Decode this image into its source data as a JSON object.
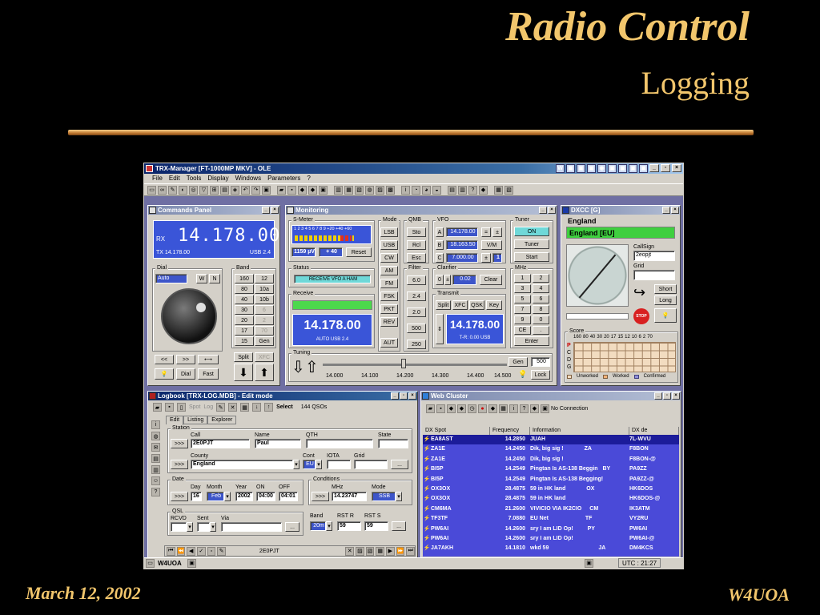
{
  "slide": {
    "title": "Radio Control",
    "subtitle": "Logging",
    "date": "March 12, 2002",
    "callsign": "W4UOA"
  },
  "app": {
    "title": "TRX-Manager [FT-1000MP MKV] - OLE",
    "menu": [
      "File",
      "Edit",
      "Tools",
      "Display",
      "Windows",
      "Parameters",
      "?"
    ],
    "status_left": "W4UOA",
    "status_clock": "UTC : 21:27"
  },
  "commands_panel": {
    "title": "Commands Panel",
    "freq_big": "14.178.00",
    "rx": "RX",
    "tx_freq": "TX 14.178.00",
    "mode_bw": "USB 2.4",
    "dial_label": "Dial",
    "dial_mode": "Auto",
    "w": "W",
    "n": "N",
    "band_label": "Band",
    "bands": [
      "160",
      "12",
      "80",
      "10a",
      "40",
      "10b",
      "30",
      "6",
      "20",
      "2",
      "17",
      "70",
      "15",
      "Gen"
    ],
    "split": "Split",
    "xfc": "XFC",
    "dial_btn": "Dial",
    "fast_btn": "Fast",
    "nav_left": "<<",
    "nav_right": ">>"
  },
  "monitoring": {
    "title": "Monitoring",
    "smeter_label": "S-Meter",
    "smeter_scale": "1 2 3 4 5 6 7 8 9 +20 +40 +60",
    "microvolt": "1159 µV",
    "db": "+ 40",
    "reset": "Reset",
    "status_label": "Status",
    "status_text": "RECEIVE VFO A HAM",
    "receive_label": "Receive",
    "rx_freq": "14.178.00",
    "rx_mode": "AUTO USB 2.4",
    "mode_label": "Mode",
    "modes": [
      "LSB",
      "USB",
      "CW",
      "AM",
      "FM",
      "FSK",
      "PKT",
      "REV",
      "AUT"
    ],
    "qmb_label": "QMB",
    "qmb": [
      "Sto",
      "Rcl",
      "Esc"
    ],
    "filter_label": "Filter",
    "filters": [
      "6.0",
      "2.4",
      "2.0",
      "500",
      "250"
    ],
    "vfo_label": "VFO",
    "vfo_a_key": "A",
    "vfo_a": "14.178.00",
    "vfo_b_key": "B",
    "vfo_b": "18.163.50",
    "vfo_c_key": "C",
    "vfo_c": "7.000.00",
    "eq": "=",
    "vm": "V/M",
    "one": "1",
    "clarifier_label": "Clarifier",
    "clar_val": "0.02",
    "clar_zero": "0",
    "clear": "Clear",
    "transmit_label": "Transmit",
    "tx_btns": [
      "Split",
      "XFC",
      "QSK",
      "Key"
    ],
    "tx_freq": "14.178.00",
    "tx_info": "T-R: 0.00 USB",
    "tuning_label": "Tuning",
    "tuning_scale": [
      "14.000",
      "14.100",
      "14.200",
      "14.300",
      "14.400",
      "14.500"
    ],
    "gen": "Gen",
    "step": "500",
    "lock": "Lock",
    "tuner_label": "Tuner",
    "tuner_on": "ON",
    "tuner_btn": "Tuner",
    "start_btn": "Start",
    "mhz_label": "MHz",
    "keypad": [
      "1",
      "2",
      "3",
      "4",
      "5",
      "6",
      "7",
      "8",
      "9",
      "0",
      "CE",
      ".",
      "Enter"
    ]
  },
  "dxcc": {
    "title": "DXCC [G]",
    "country": "England",
    "country_code": "England [EU]",
    "callsign_label": "CallSign",
    "callsign": "2eopjt",
    "grid_label": "Grid",
    "short": "Short",
    "long": "Long",
    "stop": "STOP",
    "score_label": "Score",
    "score_bands": [
      "160",
      "80",
      "40",
      "30",
      "20",
      "17",
      "15",
      "12",
      "10",
      "6",
      "2",
      "70"
    ],
    "score_rows": [
      "P",
      "C",
      "D",
      "G"
    ],
    "legend": [
      "Unworked",
      "Worked",
      "Confirmed"
    ]
  },
  "logbook": {
    "title": "Logbook [TRX-LOG.MDB] - Edit mode",
    "spot": "Spot",
    "log": "Log",
    "select": "Select",
    "qso_count": "144 QSOs",
    "tabs": [
      "Edit",
      "Listing",
      "Explorer"
    ],
    "station_label": "Station",
    "call_label": "Call",
    "call": "2E0PJT",
    "name_label": "Name",
    "name": "Paul",
    "qth_label": "QTH",
    "state_label": "State",
    "county_label": "County",
    "county": "England",
    "cont_label": "Cont",
    "cont": "EU",
    "iota_label": "IOTA",
    "grid_label": "Grid",
    "date_label": "Date",
    "day_label": "Day",
    "day": "16",
    "month_label": "Month",
    "month": "Feb",
    "year_label": "Year",
    "year": "2002",
    "on_label": "ON",
    "on": "04:00",
    "off_label": "OFF",
    "off": "04:01",
    "conditions_label": "Conditions",
    "mhz_label": "MHz",
    "mhz": "14.23747",
    "mode_label": "Mode",
    "mode": "SSB",
    "qsl_label": "QSL",
    "rcvd_label": "RCVD",
    "sent_label": "Sent",
    "via_label": "Via",
    "band_label": "Band",
    "band": "20m",
    "rstr_label": "RST R",
    "rstr": "59",
    "rsts_label": "RST S",
    "rsts": "59",
    "go": ">>>",
    "dots": "...",
    "nav_call": "2E0PJT"
  },
  "web_cluster": {
    "title": "Web Cluster",
    "connection": "No Connection",
    "headers": [
      "DX Spot",
      "Frequency",
      "Information",
      "DX de"
    ],
    "rows": [
      {
        "spot": "EA8AST",
        "freq": "14.2850",
        "info": "JUAH",
        "extra": "",
        "de": "7L-WVU"
      },
      {
        "spot": "ZA1E",
        "freq": "14.2450",
        "info": "Dik, big sig !",
        "extra": "ZA",
        "de": "F8BON"
      },
      {
        "spot": "ZA1E",
        "freq": "14.2450",
        "info": "Dik, big sig !",
        "extra": "",
        "de": "F8BON-@"
      },
      {
        "spot": "BI5P",
        "freq": "14.2549",
        "info": "Pingtan Is AS-138 Beggin",
        "extra": "BY",
        "de": "PA9ZZ"
      },
      {
        "spot": "BI5P",
        "freq": "14.2549",
        "info": "Pingtan Is AS-138 Begging!",
        "extra": "",
        "de": "PA9ZZ-@"
      },
      {
        "spot": "OX3OX",
        "freq": "28.4875",
        "info": "59 in HK land",
        "extra": "OX",
        "de": "HK6DOS"
      },
      {
        "spot": "OX3OX",
        "freq": "28.4875",
        "info": "59 in HK land",
        "extra": "",
        "de": "HK6DOS-@"
      },
      {
        "spot": "CM6MA",
        "freq": "21.2600",
        "info": "VIVICIO  VIA IK2CIO",
        "extra": "CM",
        "de": "IK3ATM"
      },
      {
        "spot": "TF3TF",
        "freq": "7.0880",
        "info": "EU Net",
        "extra": "TF",
        "de": "VY2RU"
      },
      {
        "spot": "PW6AI",
        "freq": "14.2600",
        "info": "sry I am LID Op!",
        "extra": "PY",
        "de": "PW6AI"
      },
      {
        "spot": "PW6AI",
        "freq": "14.2600",
        "info": "sry I am LID Op!",
        "extra": "",
        "de": "PW6AI-@"
      },
      {
        "spot": "JA7AKH",
        "freq": "14.1810",
        "info": "wkd 59",
        "extra": "JA",
        "de": "DM4KCS"
      }
    ]
  },
  "colors": {
    "slide_text": "#f2c66c",
    "lcd_blue": "#3a55d8",
    "cluster_blue": "#4a4ad8"
  }
}
